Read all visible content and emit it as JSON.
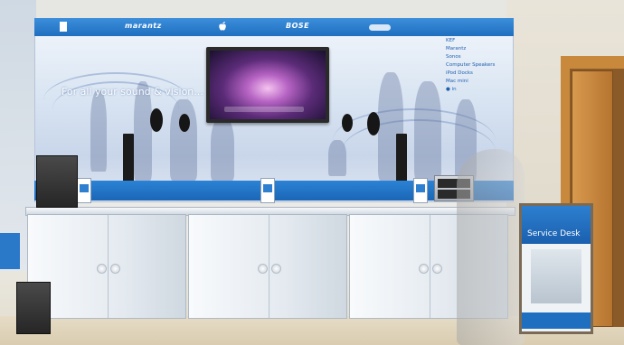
{
  "panel": {
    "brands": [
      "marantz",
      "BOSE"
    ],
    "tagline": "For all your sound & vision...",
    "nav_items": [
      "KEF",
      "Marantz",
      "Sonos",
      "Computer Speakers",
      "iPod Docks",
      "Mac mini",
      "● in"
    ]
  },
  "service_desk": {
    "title": "Service Desk"
  },
  "colors": {
    "accent_blue": "#1f6fc0",
    "wall_panel": "#d8e4f2",
    "door": "#c8893c"
  },
  "icons": [
    "apple-icon",
    "logo-icon"
  ]
}
